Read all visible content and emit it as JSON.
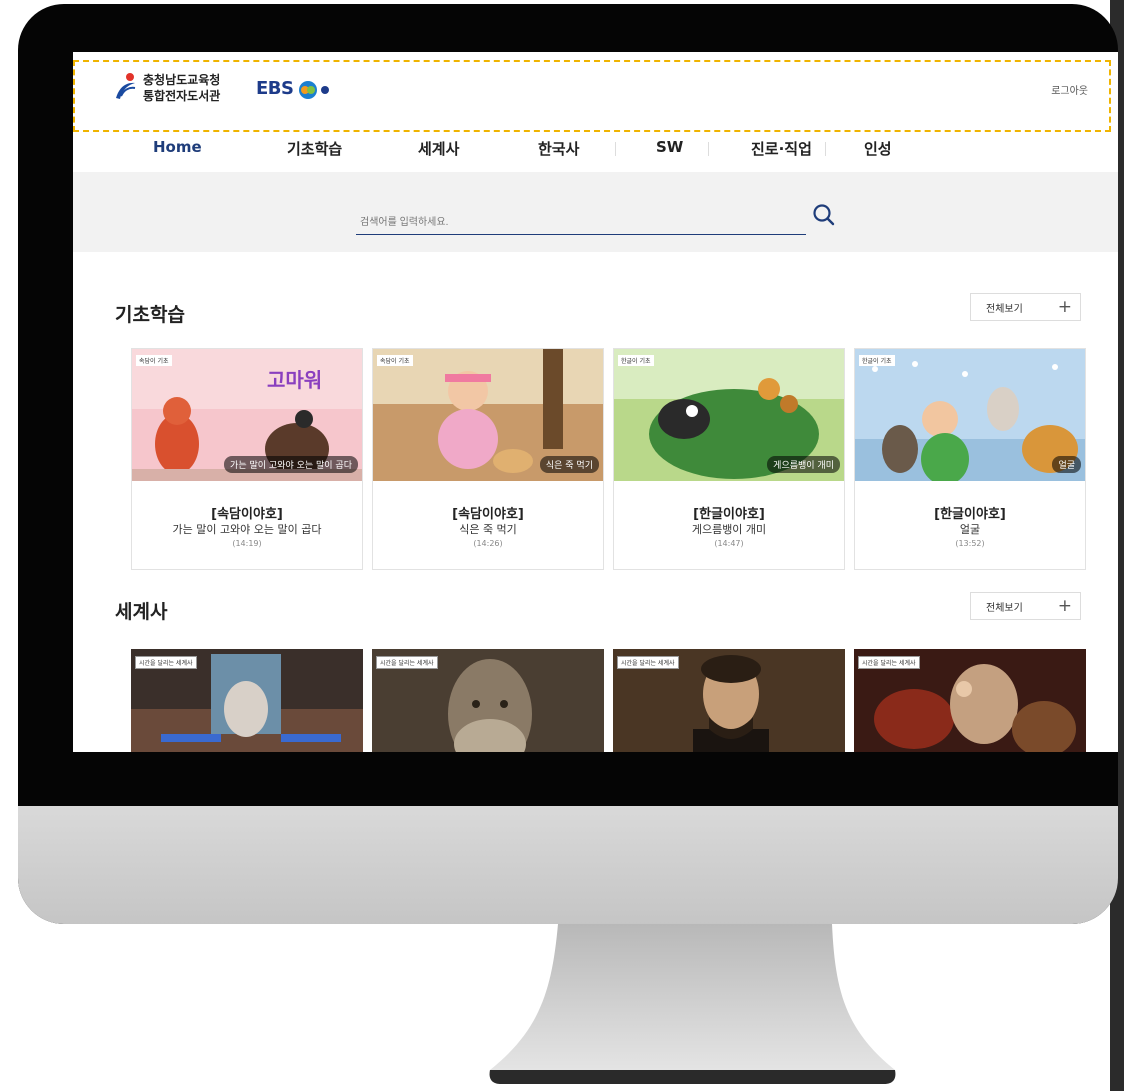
{
  "header": {
    "logo_line1": "충청남도교육청",
    "logo_line2": "통합전자도서관",
    "brand": "EBS",
    "logout_label": "로그아웃"
  },
  "nav": {
    "items": [
      "Home",
      "기초학습",
      "세계사",
      "한국사",
      "SW",
      "진로·직업",
      "인성"
    ]
  },
  "search": {
    "placeholder": "검색어를 입력하세요."
  },
  "sections": [
    {
      "title": "기초학습",
      "see_all": "전체보기",
      "cards": [
        {
          "series": "[속담이야호]",
          "title": "가는 말이 고와야 오는 말이 곱다",
          "duration": "(14:19)",
          "thumb_caption": "가는 말이 고와야 오는 말이 곱다",
          "tag": "속담이 기초"
        },
        {
          "series": "[속담이야호]",
          "title": "식은 죽 먹기",
          "duration": "(14:26)",
          "thumb_caption": "식은 죽 먹기",
          "tag": "속담이 기초"
        },
        {
          "series": "[한글이야호]",
          "title": "게으름뱅이 개미",
          "duration": "(14:47)",
          "thumb_caption": "게으름뱅이 개미",
          "tag": "한글이 기초"
        },
        {
          "series": "[한글이야호]",
          "title": "얼굴",
          "duration": "(13:52)",
          "thumb_caption": "얼굴",
          "tag": "한글이 기초"
        }
      ]
    },
    {
      "title": "세계사",
      "see_all": "전체보기",
      "cards": [
        {
          "tag": "시간을 달리는 세계사"
        },
        {
          "tag": "시간을 달리는 세계사"
        },
        {
          "tag": "시간을 달리는 세계사"
        },
        {
          "tag": "시간을 달리는 세계사"
        }
      ]
    }
  ]
}
